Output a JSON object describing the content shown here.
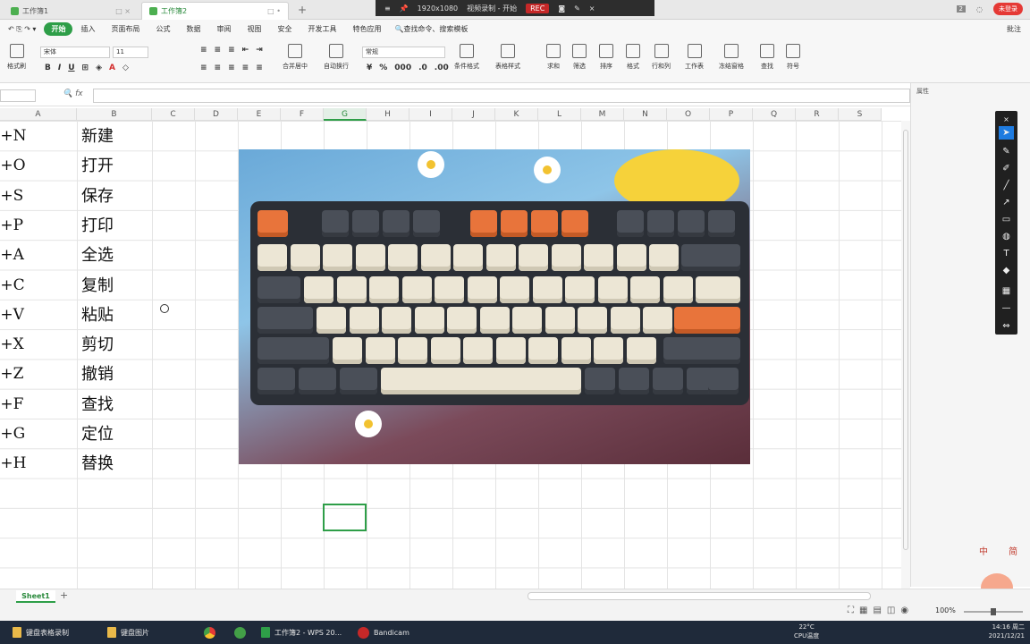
{
  "tabs": [
    {
      "label": "工作簿1"
    },
    {
      "label": "工作簿2"
    }
  ],
  "recorder": {
    "resolution": "1920x1080",
    "status": "视频录制 - 开始",
    "rec_label": "REC"
  },
  "title_badge": "2",
  "user_label": "未登录",
  "menu": {
    "items": [
      "开始",
      "插入",
      "页面布局",
      "公式",
      "数据",
      "审阅",
      "视图",
      "安全",
      "开发工具",
      "特色应用"
    ],
    "search": "查找命令、搜索模板",
    "comment": "批注"
  },
  "ribbon": {
    "format_painter": "格式刷",
    "font_name": "宋体",
    "font_size": "11",
    "merge_center": "合并居中",
    "wrap_text": "自动换行",
    "number_format": "常规",
    "cond_format": "条件格式",
    "table_style": "表格样式",
    "sum": "求和",
    "filter": "筛选",
    "sort": "排序",
    "format": "格式",
    "row_col": "行和列",
    "worksheet": "工作表",
    "freeze": "冻结窗格",
    "find": "查找",
    "symbol": "符号"
  },
  "formula": {
    "fx_label": "fx",
    "value": ""
  },
  "properties_label": "属性",
  "columns": [
    "A",
    "B",
    "C",
    "D",
    "E",
    "F",
    "G",
    "H",
    "I",
    "J",
    "K",
    "L",
    "M",
    "N",
    "O",
    "P",
    "Q",
    "R",
    "S"
  ],
  "rows": [
    {
      "a": "l+N",
      "b": "新建"
    },
    {
      "a": "l+O",
      "b": "打开"
    },
    {
      "a": "l+S",
      "b": "保存"
    },
    {
      "a": "l+P",
      "b": "打印"
    },
    {
      "a": "l+A",
      "b": "全选"
    },
    {
      "a": "l+C",
      "b": "复制"
    },
    {
      "a": "l+V",
      "b": "粘贴"
    },
    {
      "a": "l+X",
      "b": "剪切"
    },
    {
      "a": "l+Z",
      "b": "撤销"
    },
    {
      "a": "l+F",
      "b": "查找"
    },
    {
      "a": "l+G",
      "b": "定位"
    },
    {
      "a": "l+H",
      "b": "替换"
    }
  ],
  "sheet": {
    "name": "Sheet1",
    "add": "+"
  },
  "zoom": "100%",
  "taskbar": {
    "items": [
      "键盘表格录制",
      "键盘图片",
      "工作簿2 - WPS 20...",
      "Bandicam"
    ],
    "weather": "22°C",
    "cpu": "CPU温度",
    "time": "14:16 周二",
    "date": "2021/12/21"
  },
  "watermark": "中 简",
  "colors": {
    "accent": "#2e9e48",
    "rec": "#c62828",
    "taskbar": "#1f2a3a"
  }
}
